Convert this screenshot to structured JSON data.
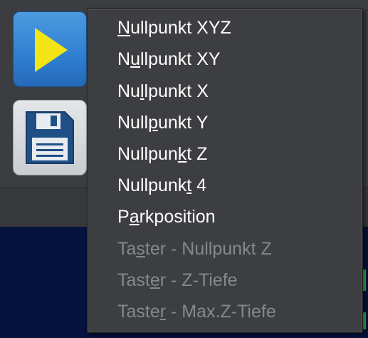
{
  "toolbar": {
    "play_icon": "play-icon",
    "save_icon": "floppy-disk-icon",
    "play_color": "#2f7fd1",
    "triangle_color": "#f3e414"
  },
  "menu": {
    "items": [
      {
        "pre": "",
        "u": "N",
        "post": "ullpunkt XYZ",
        "enabled": true
      },
      {
        "pre": "N",
        "u": "u",
        "post": "llpunkt XY",
        "enabled": true
      },
      {
        "pre": "Nu",
        "u": "l",
        "post": "lpunkt X",
        "enabled": true
      },
      {
        "pre": "Null",
        "u": "p",
        "post": "unkt Y",
        "enabled": true
      },
      {
        "pre": "Nullpun",
        "u": "k",
        "post": "t Z",
        "enabled": true
      },
      {
        "pre": "Nullpunk",
        "u": "t",
        "post": " 4",
        "enabled": true
      },
      {
        "pre": "P",
        "u": "a",
        "post": "rkposition",
        "enabled": true
      },
      {
        "pre": "Ta",
        "u": "s",
        "post": "ter - Nullpunkt Z",
        "enabled": false
      },
      {
        "pre": "Tast",
        "u": "e",
        "post": "r - Z-Tiefe",
        "enabled": false
      },
      {
        "pre": "Taste",
        "u": "r",
        "post": " - Max.Z-Tiefe",
        "enabled": false
      }
    ],
    "enabled_color": "#ffffff",
    "disabled_color": "#85888c"
  }
}
